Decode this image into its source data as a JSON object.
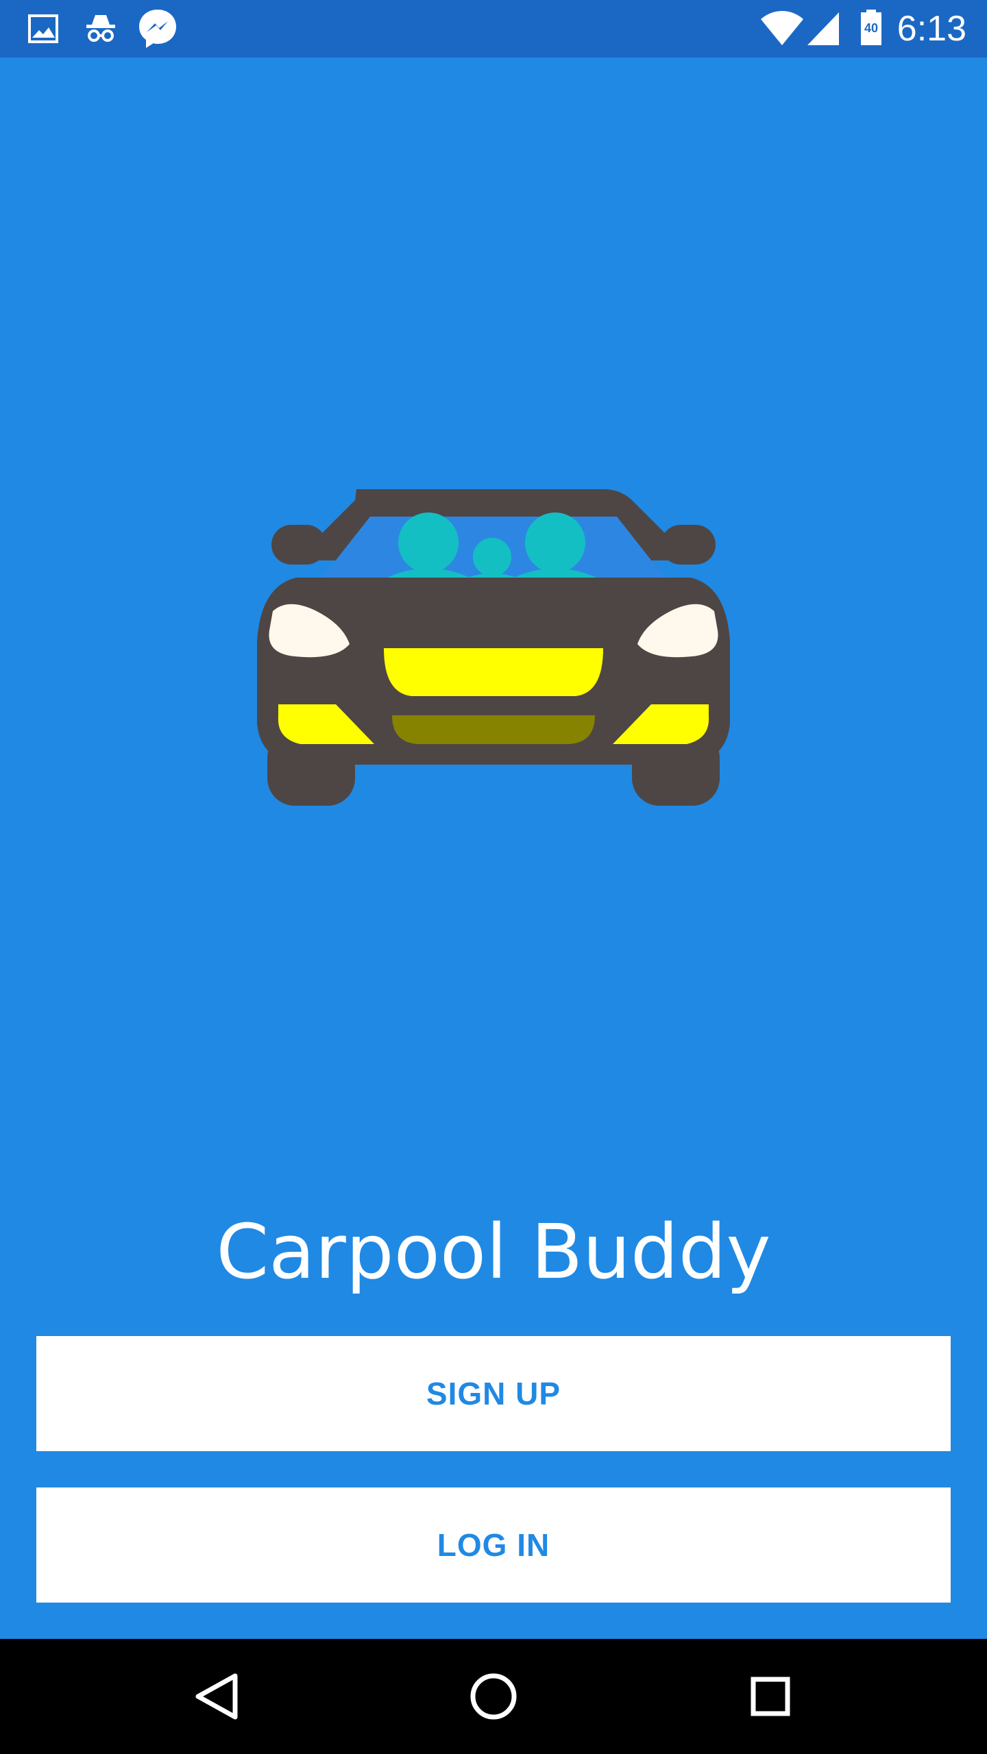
{
  "status_bar": {
    "time": "6:13",
    "battery_level": "40",
    "left_icons": [
      "image-icon",
      "incognito-icon",
      "messenger-icon"
    ],
    "right_icons": [
      "wifi-icon",
      "cell-signal-icon",
      "battery-icon"
    ]
  },
  "app": {
    "title": "Carpool Buddy",
    "logo": "car-logo",
    "colors": {
      "background": "#2089E4",
      "status_bar": "#1B68C4",
      "button_bg": "#FFFFFF",
      "button_text": "#2089E4"
    }
  },
  "actions": {
    "signup_label": "SIGN UP",
    "login_label": "LOG IN"
  },
  "nav_bar": {
    "icons": [
      "back-icon",
      "home-icon",
      "recents-icon"
    ]
  }
}
